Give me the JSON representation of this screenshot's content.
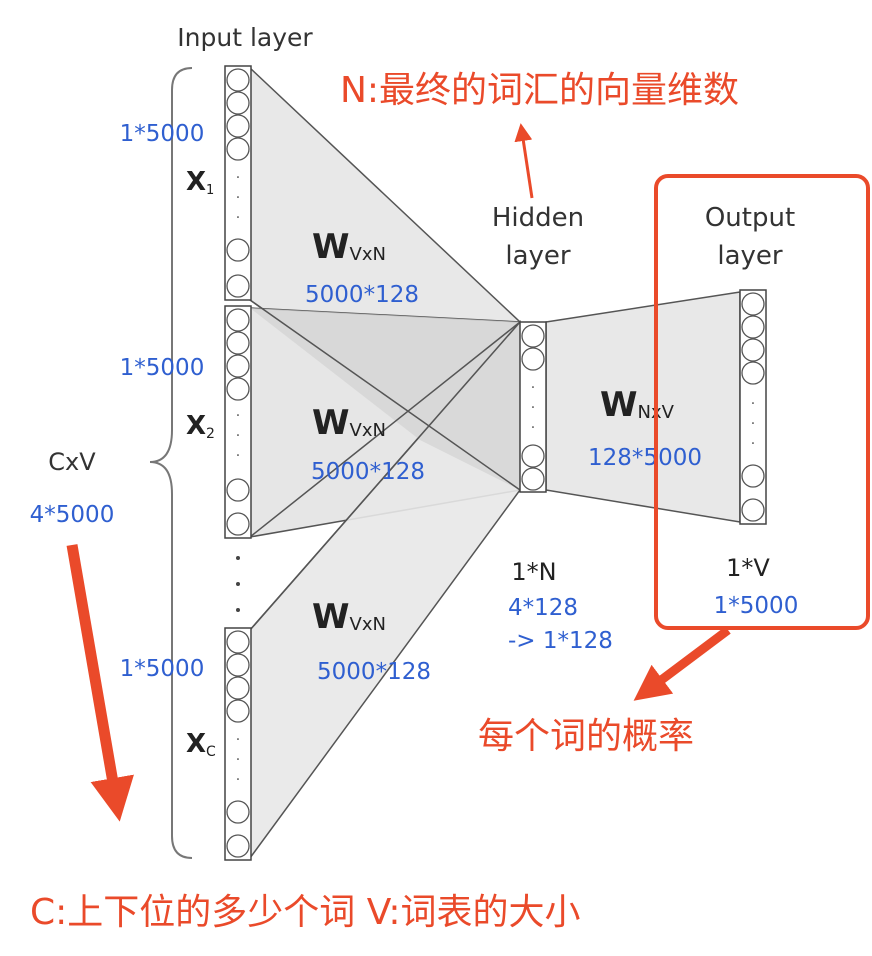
{
  "labels": {
    "input_layer": "Input layer",
    "hidden_line1": "Hidden",
    "hidden_line2": "layer",
    "output_line1": "Output",
    "output_line2": "layer",
    "x1_letter": "X",
    "x1_sub": "1",
    "x2_letter": "X",
    "x2_sub": "2",
    "xc_letter": "X",
    "xc_sub": "C",
    "cxv": "CxV",
    "w_letter": "W",
    "w_sub_vxn": "VxN",
    "w_sub_nxv": "NxV",
    "one_n": "1*N",
    "one_v": "1*V"
  },
  "annotations": {
    "dim_x1": "1*5000",
    "dim_x2": "1*5000",
    "dim_xc": "1*5000",
    "dim_cxv": "4*5000",
    "w1_dim": "5000*128",
    "w2_dim": "5000*128",
    "w3_dim": "5000*128",
    "w_out_dim": "128*5000",
    "hidden_dim_line1": "4*128",
    "hidden_dim_line2": "-> 1*128",
    "output_dim": "1*5000",
    "note_n": "N:最终的词汇的向量维数",
    "note_prob": "每个词的概率",
    "note_cv": "C:上下位的多少个词 V:词表的大小"
  },
  "colors": {
    "annotation_blue": "#2f5fd0",
    "annotation_red": "#ea4a2a",
    "trapezoid_fill": "#e8e8e8",
    "overlap_fill": "#d4d4d4",
    "line_gray": "#555555",
    "text_dark": "#222222",
    "label_gray": "#333333"
  }
}
